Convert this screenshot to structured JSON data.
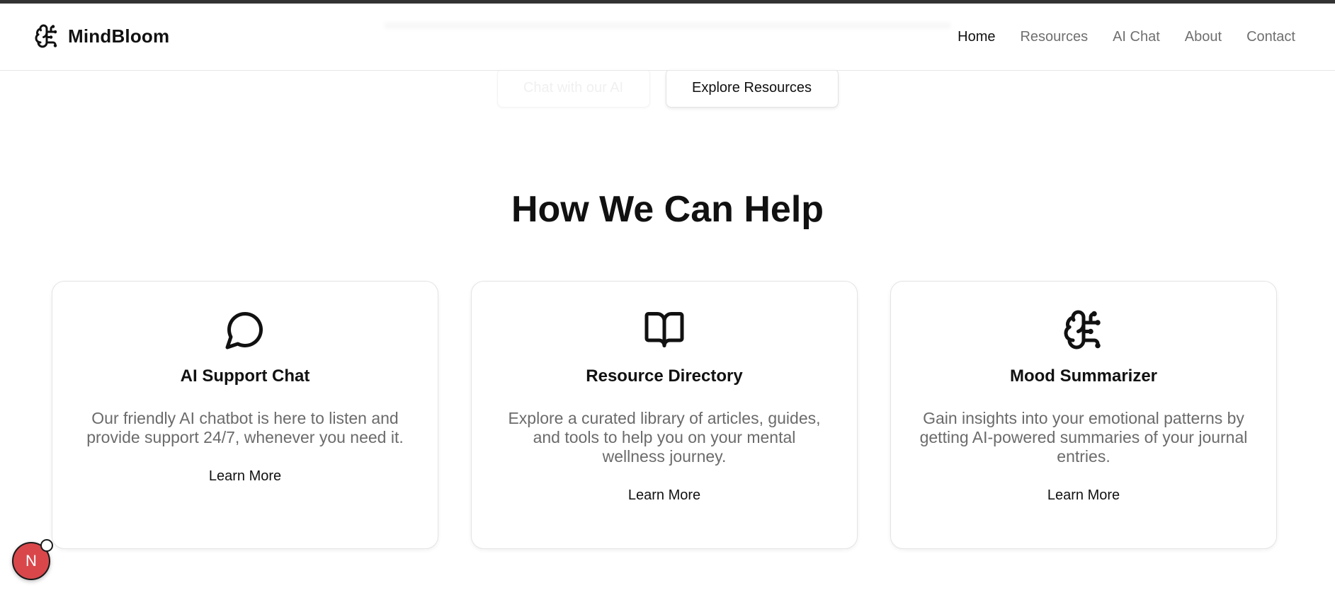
{
  "brand": {
    "name": "MindBloom",
    "icon": "brain-icon"
  },
  "nav": {
    "items": [
      {
        "label": "Home",
        "active": true
      },
      {
        "label": "Resources",
        "active": false
      },
      {
        "label": "AI Chat",
        "active": false
      },
      {
        "label": "About",
        "active": false
      },
      {
        "label": "Contact",
        "active": false
      }
    ]
  },
  "hero": {
    "primary_button_label": "Chat with our AI",
    "secondary_button_label": "Explore Resources"
  },
  "features": {
    "title": "How We Can Help",
    "cards": [
      {
        "icon": "chat-bubble-icon",
        "title": "AI Support Chat",
        "description": "Our friendly AI chatbot is here to listen and provide support 24/7, whenever you need it.",
        "link_label": "Learn More"
      },
      {
        "icon": "book-open-icon",
        "title": "Resource Directory",
        "description": "Explore a curated library of articles, guides, and tools to help you on your mental wellness journey.",
        "link_label": "Learn More"
      },
      {
        "icon": "brain-icon",
        "title": "Mood Summarizer",
        "description": "Gain insights into your emotional patterns by getting AI-powered summaries of your journal entries.",
        "link_label": "Learn More"
      }
    ]
  },
  "dev_badge": {
    "label": "N",
    "color": "#d9474b"
  },
  "colors": {
    "text": "#111111",
    "muted_text": "#6b6b6b",
    "border": "#e4e4e4"
  }
}
